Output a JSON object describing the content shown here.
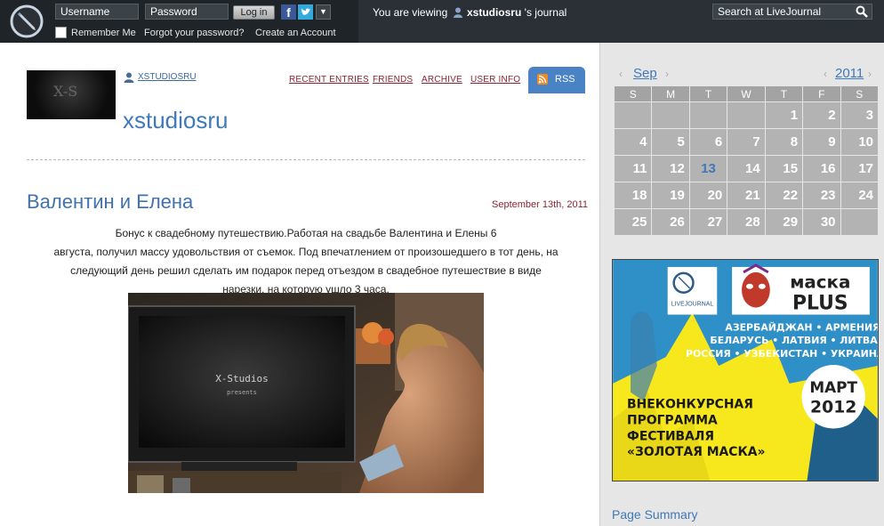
{
  "topbar": {
    "username_placeholder": "Username",
    "password_placeholder": "Password",
    "login_label": "Log in",
    "remember_label": "Remember Me",
    "forgot_label": "Forgot your password?",
    "create_label": "Create an Account",
    "viewing_prefix": "You are viewing",
    "viewing_user": "xstudiosru",
    "viewing_suffix": "'s journal",
    "search_placeholder": "Search at LiveJournal"
  },
  "header": {
    "user_link": "XSTUDIOSRU",
    "journal_title": "xstudiosru",
    "userpic_text": "X-S",
    "nav": {
      "recent": "RECENT ENTRIES",
      "friends": "FRIENDS",
      "archive": "ARCHIVE",
      "userinfo": "USER INFO"
    },
    "rss_label": "RSS"
  },
  "entry": {
    "title": "Валентин и Елена",
    "date": "September 13th, 2011",
    "text_lines": [
      "Бонус к свадебному путешествию.Работая на свадьбе Валентина и Елены 6",
      "августа, получил массу удовольствия от съемок. Под впечатлением от произошедшего в тот день, на",
      "следующий день решил сделать им подарок перед отъездом в свадебное путешествие в виде",
      "нарезки, на которую ушло 3 часа."
    ],
    "image_caption_1": "X-Studios",
    "image_caption_2": "presents"
  },
  "calendar": {
    "month": "Sep",
    "year": "2011",
    "weekdays": [
      "S",
      "M",
      "T",
      "W",
      "T",
      "F",
      "S"
    ],
    "weeks": [
      [
        "",
        "",
        "",
        "",
        "1",
        "2",
        "3"
      ],
      [
        "4",
        "5",
        "6",
        "7",
        "8",
        "9",
        "10"
      ],
      [
        "11",
        "12",
        "13",
        "14",
        "15",
        "16",
        "17"
      ],
      [
        "18",
        "19",
        "20",
        "21",
        "22",
        "23",
        "24"
      ],
      [
        "25",
        "26",
        "27",
        "28",
        "29",
        "30",
        ""
      ]
    ],
    "today": "13"
  },
  "ad": {
    "lj_label": "LIVEJOURNAL",
    "brand_line1": "маска",
    "brand_line2": "PLUS",
    "countries_1": "АЗЕРБАЙДЖАН • АРМЕНИЯ",
    "countries_2": "БЕЛАРУСЬ • ЛАТВИЯ • ЛИТВА",
    "countries_3": "РОССИЯ • УЗБЕКИСТАН • УКРАИНА",
    "date_1": "МАРТ",
    "date_2": "2012",
    "program_1": "ВНЕКОНКУРСНАЯ",
    "program_2": "ПРОГРАММА",
    "program_3": "ФЕСТИВАЛЯ",
    "program_4": "«ЗОЛОТАЯ МАСКА»"
  },
  "sidebar": {
    "page_summary": "Page Summary"
  },
  "colors": {
    "topbar_bg": "#1f2428",
    "link_blue": "#3f79b8",
    "nav_red": "#8b2332",
    "calendar_cell": "#b3b3b3",
    "sidebar_bg": "#e6e6e6"
  }
}
